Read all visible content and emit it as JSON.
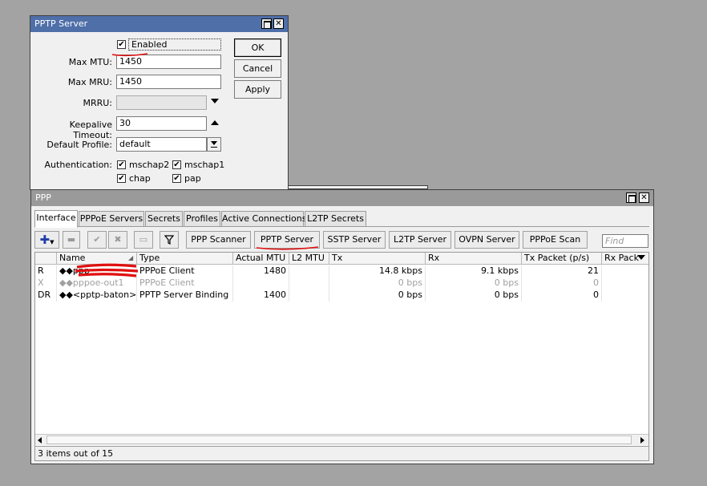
{
  "pptp": {
    "title": "PPTP Server",
    "enabled_label": "Enabled",
    "labels": {
      "max_mtu": "Max MTU:",
      "max_mru": "Max MRU:",
      "mrru": "MRRU:",
      "keepalive": "Keepalive Timeout:",
      "default_profile": "Default Profile:",
      "authentication": "Authentication:"
    },
    "values": {
      "max_mtu": "1450",
      "max_mru": "1450",
      "mrru": "",
      "keepalive": "30",
      "default_profile": "default"
    },
    "auth": {
      "mschap2": "mschap2",
      "mschap1": "mschap1",
      "chap": "chap",
      "pap": "pap"
    },
    "buttons": {
      "ok": "OK",
      "cancel": "Cancel",
      "apply": "Apply"
    }
  },
  "ppp": {
    "title": "PPP",
    "tabs": [
      "Interface",
      "PPPoE Servers",
      "Secrets",
      "Profiles",
      "Active Connections",
      "L2TP Secrets"
    ],
    "toolbar": [
      "PPP Scanner",
      "PPTP Server",
      "SSTP Server",
      "L2TP Server",
      "OVPN Server",
      "PPPoE Scan"
    ],
    "find_placeholder": "Find",
    "columns": [
      "",
      "Name",
      "Type",
      "Actual MTU",
      "L2 MTU",
      "Tx",
      "Rx",
      "Tx Packet (p/s)",
      "Rx Pack"
    ],
    "rows": [
      {
        "flag": "R",
        "name": "◆◆ppp",
        "type": "PPPoE Client",
        "mtu": "1480",
        "l2mtu": "",
        "tx": "14.8 kbps",
        "rx": "9.1 kbps",
        "txp": "21"
      },
      {
        "flag": "X",
        "name": "◆◆pppoe-out1",
        "type": "PPPoE Client",
        "mtu": "",
        "l2mtu": "",
        "tx": "0 bps",
        "rx": "0 bps",
        "txp": "0"
      },
      {
        "flag": "DR",
        "name": "◆◆<pptp-baton>",
        "type": "PPTP Server Binding",
        "mtu": "1400",
        "l2mtu": "",
        "tx": "0 bps",
        "rx": "0 bps",
        "txp": "0"
      }
    ],
    "status": "3 items out of 15"
  },
  "colors": {
    "title_active": "#4f6fa9",
    "annotation": "#e01010"
  }
}
